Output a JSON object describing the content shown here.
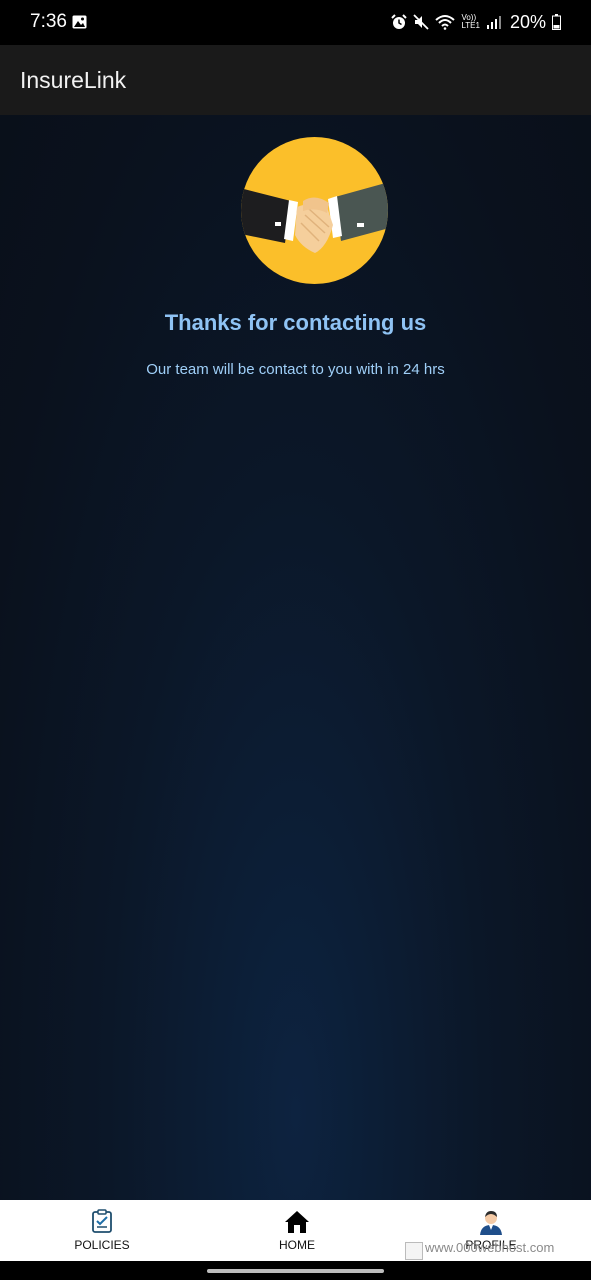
{
  "status_bar": {
    "time": "7:36",
    "battery": "20%",
    "icons": [
      "gallery-icon",
      "alarm-icon",
      "mute-icon",
      "wifi-icon",
      "volte-icon",
      "signal-icon",
      "battery-icon"
    ],
    "volte_label_top": "Vo))",
    "volte_label_bottom": "LTE1"
  },
  "app_bar": {
    "title": "InsureLink"
  },
  "main": {
    "illustration": "handshake-icon",
    "title": "Thanks for contacting us",
    "subtitle": "Our team will be contact to you with in 24 hrs"
  },
  "bottom_nav": {
    "items": [
      {
        "label": "POLICIES",
        "icon": "policies-icon"
      },
      {
        "label": "HOME",
        "icon": "home-icon"
      },
      {
        "label": "PROFILE",
        "icon": "profile-icon"
      }
    ]
  },
  "watermark": {
    "text": "www.000webhost.com"
  },
  "colors": {
    "accent": "#8fc3f4",
    "circle": "#fbbf2a",
    "app_bar": "#1a1a1a",
    "background": "#0a1320"
  }
}
